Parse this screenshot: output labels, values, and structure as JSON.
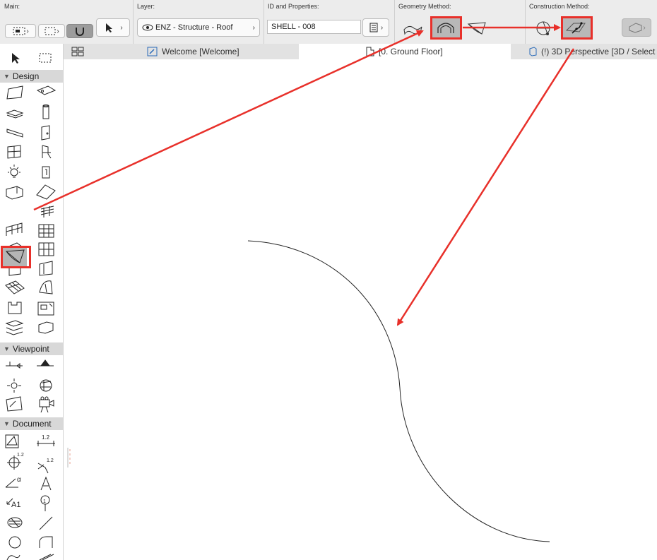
{
  "infobox": {
    "main_title": "Main:",
    "layer_title": "Layer:",
    "layer_value": "ENZ - Structure - Roof",
    "id_title": "ID and Properties:",
    "id_value": "SHELL - 008",
    "geometry_title": "Geometry Method:",
    "construction_title": "Construction Method:"
  },
  "tabs": [
    {
      "label": "Welcome [Welcome]",
      "icon": "welcome-icon"
    },
    {
      "label": "[0. Ground Floor]",
      "icon": "floor-plan-icon",
      "active": true
    },
    {
      "label": "(!) 3D Perspective [3D / Select",
      "icon": "3d-view-icon"
    }
  ],
  "toolbox": {
    "sections": [
      "Design",
      "Viewpoint",
      "Document"
    ],
    "selected_tool": "shell-tool"
  },
  "annotations": {
    "color": "#e8302a",
    "marks": [
      "shell-tool",
      "geometry-revolved",
      "construction-contour"
    ]
  }
}
